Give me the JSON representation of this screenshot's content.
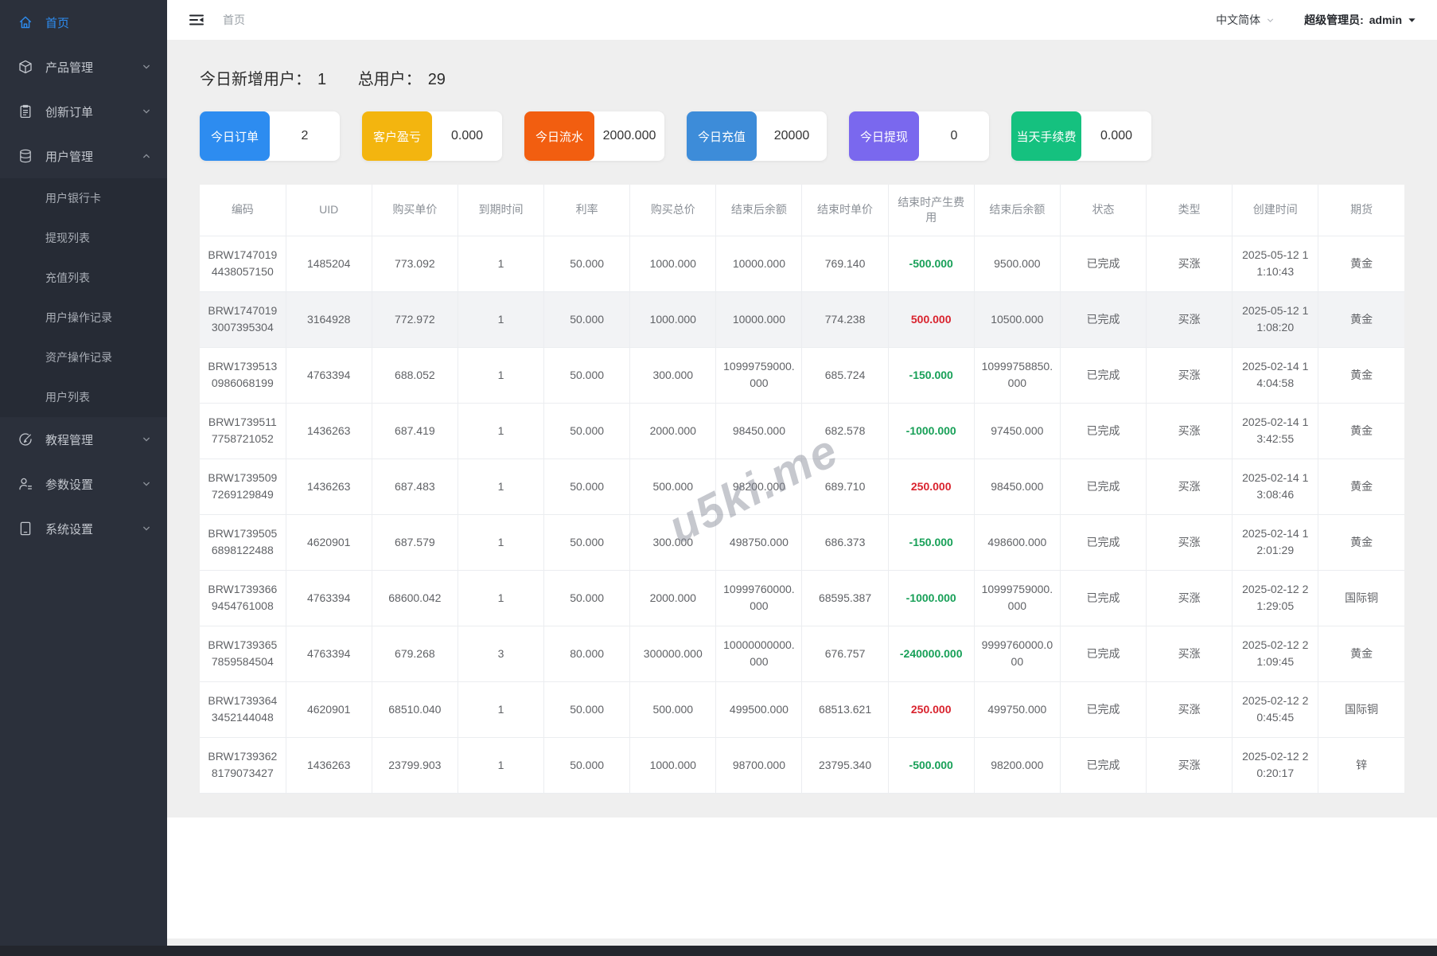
{
  "topbar": {
    "breadcrumb": "首页",
    "language": "中文简体",
    "user_role_label": "超级管理员:",
    "username": "admin"
  },
  "sidebar": {
    "items": [
      {
        "id": "home",
        "label": "首页",
        "icon": "home-icon",
        "active": true,
        "chevron": null
      },
      {
        "id": "products",
        "label": "产品管理",
        "icon": "product-icon",
        "active": false,
        "chevron": "down"
      },
      {
        "id": "orders",
        "label": "创新订单",
        "icon": "order-icon",
        "active": false,
        "chevron": "down"
      },
      {
        "id": "users",
        "label": "用户管理",
        "icon": "users-icon",
        "active": false,
        "chevron": "up",
        "children": [
          "用户银行卡",
          "提现列表",
          "充值列表",
          "用户操作记录",
          "资产操作记录",
          "用户列表"
        ]
      },
      {
        "id": "tutorials",
        "label": "教程管理",
        "icon": "tutorial-icon",
        "active": false,
        "chevron": "down"
      },
      {
        "id": "params",
        "label": "参数设置",
        "icon": "params-icon",
        "active": false,
        "chevron": "down"
      },
      {
        "id": "system",
        "label": "系统设置",
        "icon": "system-icon",
        "active": false,
        "chevron": "down"
      }
    ]
  },
  "stats": {
    "new_users_label": "今日新增用户：",
    "new_users_value": "1",
    "total_users_label": "总用户：",
    "total_users_value": "29"
  },
  "cards": [
    {
      "label": "今日订单",
      "value": "2",
      "color": "#2d8cf0"
    },
    {
      "label": "客户盈亏",
      "value": "0.000",
      "color": "#f3b50f"
    },
    {
      "label": "今日流水",
      "value": "2000.000",
      "color": "#f25e10"
    },
    {
      "label": "今日充值",
      "value": "20000",
      "color": "#3d8cd9"
    },
    {
      "label": "今日提现",
      "value": "0",
      "color": "#7a68ee"
    },
    {
      "label": "当天手续费",
      "value": "0.000",
      "color": "#15c17f"
    }
  ],
  "watermark": "u5ki.me",
  "table": {
    "columns": [
      "编码",
      "UID",
      "购买单价",
      "到期时间",
      "利率",
      "购买总价",
      "结束后余额",
      "结束时单价",
      "结束时产生费用",
      "结束后余额",
      "状态",
      "类型",
      "创建时间",
      "期货"
    ],
    "fee_column_index": 8,
    "rows": [
      {
        "cells": [
          "BRW17470194438057150",
          "1485204",
          "773.092",
          "1",
          "50.000",
          "1000.000",
          "10000.000",
          "769.140",
          "-500.000",
          "9500.000",
          "已完成",
          "买涨",
          "2025-05-12 11:10:43",
          "黄金"
        ],
        "fee_color": "green",
        "hover": false
      },
      {
        "cells": [
          "BRW17470193007395304",
          "3164928",
          "772.972",
          "1",
          "50.000",
          "1000.000",
          "10000.000",
          "774.238",
          "500.000",
          "10500.000",
          "已完成",
          "买涨",
          "2025-05-12 11:08:20",
          "黄金"
        ],
        "fee_color": "red",
        "hover": true
      },
      {
        "cells": [
          "BRW17395130986068199",
          "4763394",
          "688.052",
          "1",
          "50.000",
          "300.000",
          "10999759000.000",
          "685.724",
          "-150.000",
          "10999758850.000",
          "已完成",
          "买涨",
          "2025-02-14 14:04:58",
          "黄金"
        ],
        "fee_color": "green",
        "hover": false
      },
      {
        "cells": [
          "BRW17395117758721052",
          "1436263",
          "687.419",
          "1",
          "50.000",
          "2000.000",
          "98450.000",
          "682.578",
          "-1000.000",
          "97450.000",
          "已完成",
          "买涨",
          "2025-02-14 13:42:55",
          "黄金"
        ],
        "fee_color": "green",
        "hover": false
      },
      {
        "cells": [
          "BRW17395097269129849",
          "1436263",
          "687.483",
          "1",
          "50.000",
          "500.000",
          "98200.000",
          "689.710",
          "250.000",
          "98450.000",
          "已完成",
          "买涨",
          "2025-02-14 13:08:46",
          "黄金"
        ],
        "fee_color": "red",
        "hover": false
      },
      {
        "cells": [
          "BRW17395056898122488",
          "4620901",
          "687.579",
          "1",
          "50.000",
          "300.000",
          "498750.000",
          "686.373",
          "-150.000",
          "498600.000",
          "已完成",
          "买涨",
          "2025-02-14 12:01:29",
          "黄金"
        ],
        "fee_color": "green",
        "hover": false
      },
      {
        "cells": [
          "BRW17393669454761008",
          "4763394",
          "68600.042",
          "1",
          "50.000",
          "2000.000",
          "10999760000.000",
          "68595.387",
          "-1000.000",
          "10999759000.000",
          "已完成",
          "买涨",
          "2025-02-12 21:29:05",
          "国际铜"
        ],
        "fee_color": "green",
        "hover": false
      },
      {
        "cells": [
          "BRW17393657859584504",
          "4763394",
          "679.268",
          "3",
          "80.000",
          "300000.000",
          "10000000000.000",
          "676.757",
          "-240000.000",
          "9999760000.000",
          "已完成",
          "买涨",
          "2025-02-12 21:09:45",
          "黄金"
        ],
        "fee_color": "green",
        "hover": false
      },
      {
        "cells": [
          "BRW17393643452144048",
          "4620901",
          "68510.040",
          "1",
          "50.000",
          "500.000",
          "499500.000",
          "68513.621",
          "250.000",
          "499750.000",
          "已完成",
          "买涨",
          "2025-02-12 20:45:45",
          "国际铜"
        ],
        "fee_color": "red",
        "hover": false
      },
      {
        "cells": [
          "BRW17393628179073427",
          "1436263",
          "23799.903",
          "1",
          "50.000",
          "1000.000",
          "98700.000",
          "23795.340",
          "-500.000",
          "98200.000",
          "已完成",
          "买涨",
          "2025-02-12 20:20:17",
          "锌"
        ],
        "fee_color": "green",
        "hover": false
      }
    ]
  }
}
